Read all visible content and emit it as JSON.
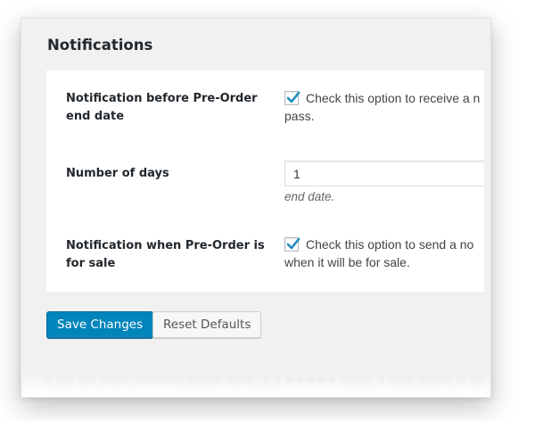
{
  "section": {
    "title": "Notifications"
  },
  "settings": [
    {
      "label": "Notification before Pre-Order end date",
      "checked": true,
      "text_line1": "Check this option to receive a n",
      "text_line2": "pass."
    },
    {
      "label": "Number of days",
      "value": "1",
      "description": "end date."
    },
    {
      "label": "Notification when Pre-Order is for sale",
      "checked": true,
      "text_line1": "Check this option to send a no",
      "text_line2": "when it will be for sale."
    }
  ],
  "actions": {
    "save_label": "Save Changes",
    "reset_label": "Reset Defaults"
  },
  "footer": {
    "text": "If you like WooCommerce please leave us a ★★★★★ rating. A huge thanks in ad"
  },
  "colors": {
    "primary": "#0085ba",
    "check": "#1e8cbe",
    "background": "#f1f1f1"
  }
}
